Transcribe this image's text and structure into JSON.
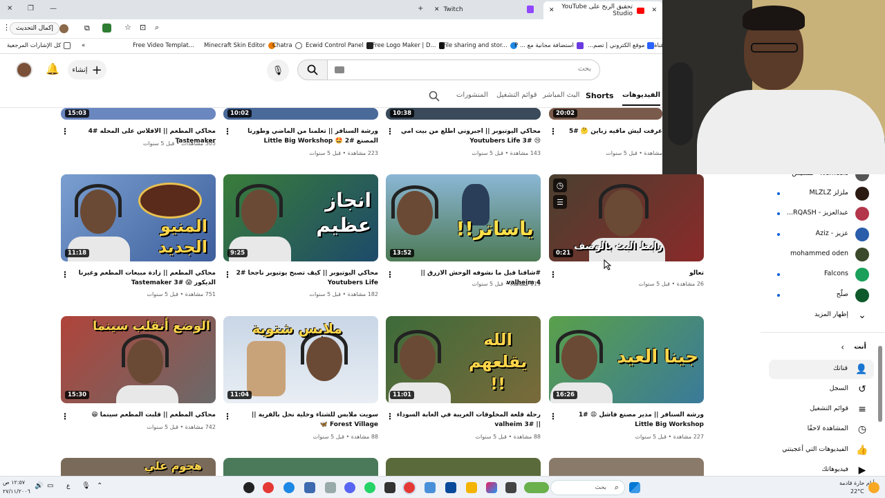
{
  "browser": {
    "tabs": [
      {
        "label": "تحقيق الربح على YouTube Studio",
        "active": true
      },
      {
        "label": "Twitch",
        "active": false
      }
    ],
    "update_button": "إكمال التحديث",
    "bookmarks_all": "كل الإشارات المرجعية",
    "bookmarks": [
      "Free Video Templat...",
      "Minecraft Skin Editor",
      "Chatra",
      "Ecwid Control Panel",
      "Free Logo Maker | D...",
      "File sharing and stor...",
      "استضافة مجانية مع ... P",
      "موقع الكتروني | تصم...",
      "قناة"
    ]
  },
  "youtube": {
    "search_placeholder": "بحث",
    "create_label": "إنشاء",
    "channel_tabs": [
      "الفيديوهات",
      "Shorts",
      "البث المباشر",
      "قوائم التشغيل",
      "المنشورات"
    ],
    "rows": [
      [
        {
          "title": "محاكي المطعم || الافلاس على المحله #4 Tastemaker",
          "meta": "505 مشاهدات • قبل 5 سنوات",
          "duration": "15:03"
        },
        {
          "title": "ورشة السنافر || تعلمنا من الماضي وطورنا المصنع #2 🤩 Little Big Workshop",
          "meta": "223 مشاهدة • قبل 5 سنوات",
          "duration": "10:02"
        },
        {
          "title": "محاكي اليوتيوبر || اجبروني اطلع من بيت امي 😢 #3 Youtubers Life",
          "meta": "143 مشاهدة • قبل 5 سنوات",
          "duration": "10:38"
        },
        {
          "title": "عرفت ليش ماقيه زباين 🤔 #5",
          "meta": "مشاهدة • قبل 5 سنوات",
          "duration": "20:02"
        }
      ],
      [
        {
          "title": "محاكي المطعم || زادة مبيعات المطعم وغيرنا الديكور 😱 #3 Tastemaker",
          "meta": "751 مشاهدة • قبل 5 سنوات",
          "duration": "11:18",
          "overlay": "المنيو الجديد"
        },
        {
          "title": "محاكي اليوتيوبر || كيف تصبح يوتيوبر ناجحا #2 Youtubers Life",
          "meta": "182 مشاهدة • قبل 5 سنوات",
          "duration": "9:25",
          "overlay": "انجاز عظيم"
        },
        {
          "title": "#شافنا قبل ما نشوفه الوحش الازرق || valheim 4",
          "meta": "119 مشاهدة • قبل 5 سنوات",
          "duration": "13:52",
          "overlay": "!!ياساتر"
        },
        {
          "title": "تعالو",
          "meta": "26 مشاهدة • قبل 5 سنوات",
          "duration": "0:21",
          "overlay": "رابط البث بالوصف"
        }
      ],
      [
        {
          "title": "محاكي المطعم || قلبت المطعم سينما 😁",
          "meta": "742 مشاهدة • قبل 5 سنوات",
          "duration": "15:30",
          "overlay": "الوضع أنقلب سينما"
        },
        {
          "title": "سويت ملابس للشتاء وخلية نحل بالقرية || Forest Village 🦋",
          "meta": "88 مشاهدة • قبل 5 سنوات",
          "duration": "11:04",
          "overlay": "ملابس شتوية"
        },
        {
          "title": "رحلة قلعة المخلوقات الغريبة في الغابة السوداء || valheim 3#",
          "meta": "88 مشاهدة • قبل 5 سنوات",
          "duration": "11:01",
          "overlay": "الله يقلعهم !!"
        },
        {
          "title": "ورشة السنافر || مدير مصنع فاشل 😩 #1 Little Big Workshop",
          "meta": "227 مشاهدة • قبل 5 سنوات",
          "duration": "16:26",
          "overlay": "جينا العيد"
        }
      ]
    ],
    "bottom_row_overlay": "هجوم علي"
  },
  "sidebar": {
    "subscriptions": [
      {
        "label": "Nemesis - نمسيس",
        "color": "#555555"
      },
      {
        "label": "ملزلز MLZLZ",
        "color": "#2b1a12"
      },
      {
        "label": "عبدالعزيز - RQASH...",
        "color": "#b3364a"
      },
      {
        "label": "عزيز - Aziz",
        "color": "#2a5eaa"
      },
      {
        "label": "mohammed oden",
        "color": "#3a4a2a"
      },
      {
        "label": "Falcons",
        "color": "#1aa05a"
      },
      {
        "label": "صلّح",
        "color": "#0f5a2a"
      }
    ],
    "show_more": "إظهار المزيد",
    "you_header": "أنت",
    "you_items": [
      {
        "label": "قناتك",
        "icon": "person-icon"
      },
      {
        "label": "السجل",
        "icon": "history-icon"
      },
      {
        "label": "قوائم التشغيل",
        "icon": "playlist-icon"
      },
      {
        "label": "المشاهدة لاحقًا",
        "icon": "clock-icon"
      },
      {
        "label": "الفيديوهات التي أعجبتني",
        "icon": "like-icon"
      },
      {
        "label": "فيديوهاتك",
        "icon": "video-icon"
      }
    ]
  },
  "taskbar": {
    "search_placeholder": "بحث",
    "weather": "أيام حارة قادمة",
    "temp": "22°C",
    "time": "١٢:٥٧ ص",
    "date": "٢٧/١١/٢٠٠٦",
    "lang": "ع"
  }
}
